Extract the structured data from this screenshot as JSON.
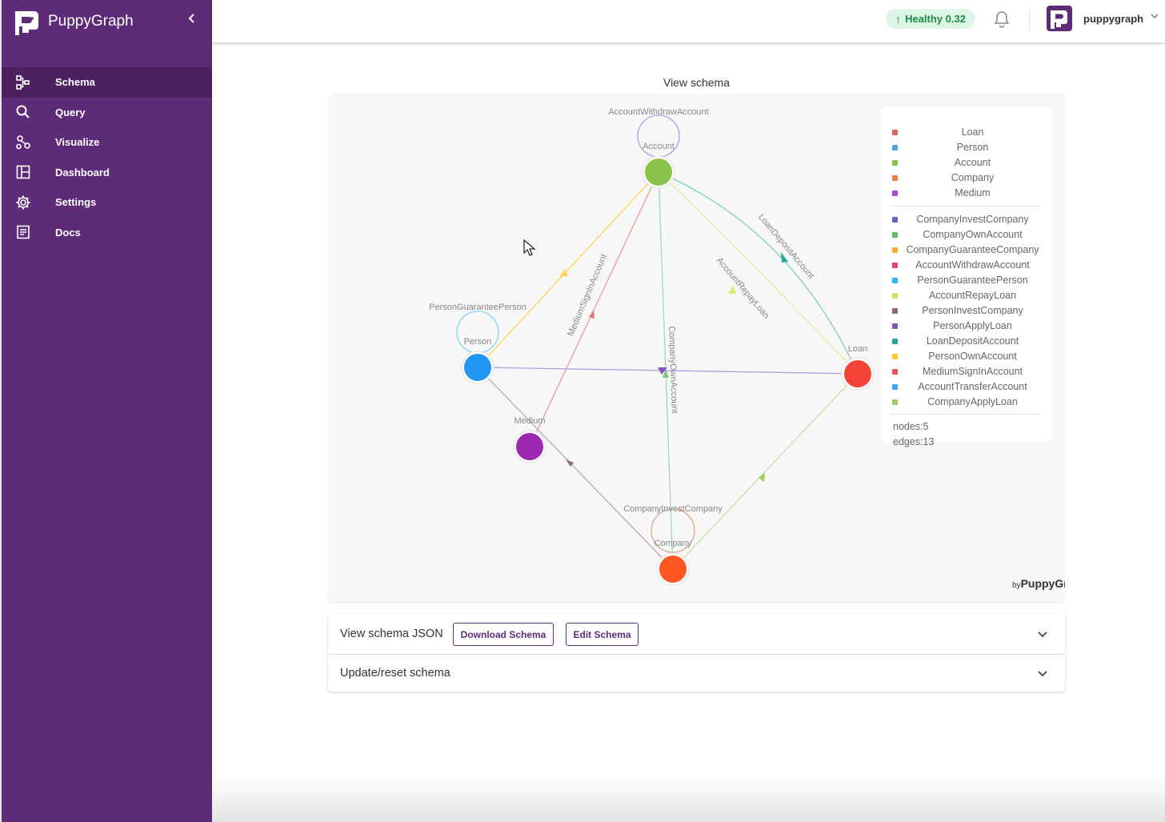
{
  "app": {
    "name": "PuppyGraph"
  },
  "sidebar": {
    "items": [
      {
        "label": "Schema",
        "icon": "schema-icon",
        "active": true
      },
      {
        "label": "Query",
        "icon": "search-icon",
        "active": false
      },
      {
        "label": "Visualize",
        "icon": "visualize-icon",
        "active": false
      },
      {
        "label": "Dashboard",
        "icon": "dashboard-icon",
        "active": false
      },
      {
        "label": "Settings",
        "icon": "gear-icon",
        "active": false
      },
      {
        "label": "Docs",
        "icon": "docs-icon",
        "active": false
      }
    ]
  },
  "header": {
    "health_label": "Healthy 0.32",
    "username": "puppygraph"
  },
  "schema": {
    "title": "View schema",
    "nodes": [
      {
        "id": "Account",
        "label": "Account",
        "color": "#8bc34a"
      },
      {
        "id": "Person",
        "label": "Person",
        "color": "#2196f3"
      },
      {
        "id": "Medium",
        "label": "Medium",
        "color": "#9c27b0"
      },
      {
        "id": "Loan",
        "label": "Loan",
        "color": "#f44336"
      },
      {
        "id": "Company",
        "label": "Company",
        "color": "#ff5722"
      }
    ],
    "edge_labels": {
      "account_withdraw": "AccountWithdrawAccount",
      "person_guarantee": "PersonGuaranteePerson",
      "medium_signin": "MediumSignInAccount",
      "company_own": "CompanyOwnAccount",
      "account_repay": "AccountRepayLoan",
      "loan_deposit": "LoanDepositAccount",
      "company_invest": "CompanyInvestCompany"
    },
    "legend_nodes": [
      {
        "label": "Loan",
        "color": "#e06363"
      },
      {
        "label": "Person",
        "color": "#4aa3df"
      },
      {
        "label": "Account",
        "color": "#8bc34a"
      },
      {
        "label": "Company",
        "color": "#ef7b45"
      },
      {
        "label": "Medium",
        "color": "#a64ac9"
      }
    ],
    "legend_edges": [
      {
        "label": "CompanyInvestCompany",
        "color": "#5c6bc0"
      },
      {
        "label": "CompanyOwnAccount",
        "color": "#66bb6a"
      },
      {
        "label": "CompanyGuaranteeCompany",
        "color": "#ffa726"
      },
      {
        "label": "AccountWithdrawAccount",
        "color": "#ec407a"
      },
      {
        "label": "PersonGuaranteePerson",
        "color": "#29b6f6"
      },
      {
        "label": "AccountRepayLoan",
        "color": "#d4e157"
      },
      {
        "label": "PersonInvestCompany",
        "color": "#8d6e63"
      },
      {
        "label": "PersonApplyLoan",
        "color": "#7e57c2"
      },
      {
        "label": "LoanDepositAccount",
        "color": "#26a69a"
      },
      {
        "label": "PersonOwnAccount",
        "color": "#ffca28"
      },
      {
        "label": "MediumSignInAccount",
        "color": "#ef5350"
      },
      {
        "label": "AccountTransferAccount",
        "color": "#42a5f5"
      },
      {
        "label": "CompanyApplyLoan",
        "color": "#9ccc65"
      }
    ],
    "stats": {
      "nodes": "nodes:5",
      "edges": "edges:13"
    },
    "brandmark_by": "by",
    "brandmark_name": "PuppyGraph"
  },
  "panels": {
    "json_title": "View schema JSON",
    "download_label": "Download Schema",
    "edit_label": "Edit Schema",
    "update_title": "Update/reset schema"
  }
}
